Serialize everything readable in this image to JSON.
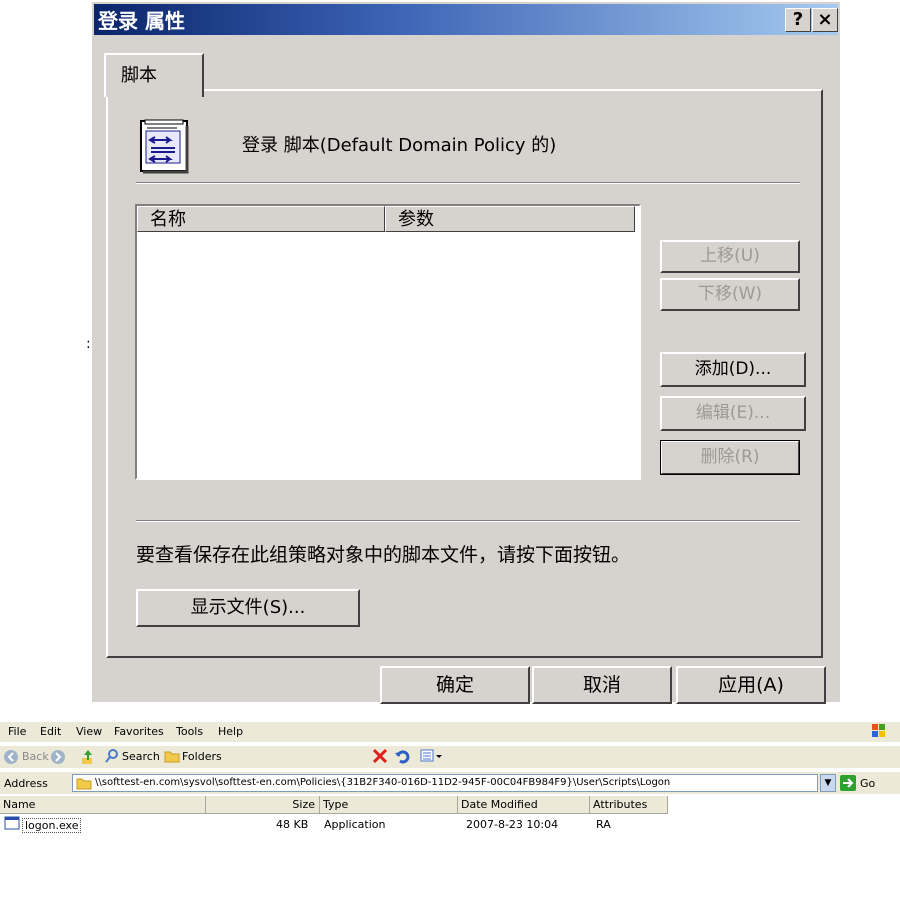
{
  "dialog": {
    "title": "登录 属性",
    "help_btn": "?",
    "close_btn": "×",
    "tab": "脚本",
    "heading": "登录 脚本(Default Domain Policy 的)",
    "columns": [
      "名称",
      "参数"
    ],
    "buttons": {
      "up": "上移(U)",
      "down": "下移(W)",
      "add": "添加(D)...",
      "edit": "编辑(E)...",
      "remove": "删除(R)"
    },
    "note": "要查看保存在此组策略对象中的脚本文件，请按下面按钮。",
    "show_files": "显示文件(S)...",
    "ok": "确定",
    "cancel": "取消",
    "apply": "应用(A)"
  },
  "explorer": {
    "menu": [
      "File",
      "Edit",
      "View",
      "Favorites",
      "Tools",
      "Help"
    ],
    "toolbar": {
      "back": "Back",
      "search": "Search",
      "folders": "Folders"
    },
    "address_label": "Address",
    "address": "\\\\softtest-en.com\\sysvol\\softtest-en.com\\Policies\\{31B2F340-016D-11D2-945F-00C04FB984F9}\\User\\Scripts\\Logon",
    "go": "Go",
    "columns": {
      "name": "Name",
      "size": "Size",
      "type": "Type",
      "modified": "Date Modified",
      "attributes": "Attributes"
    },
    "file": {
      "name": "logon.exe",
      "size": "48 KB",
      "type": "Application",
      "modified": "2007-8-23 10:04",
      "attributes": "RA"
    }
  }
}
